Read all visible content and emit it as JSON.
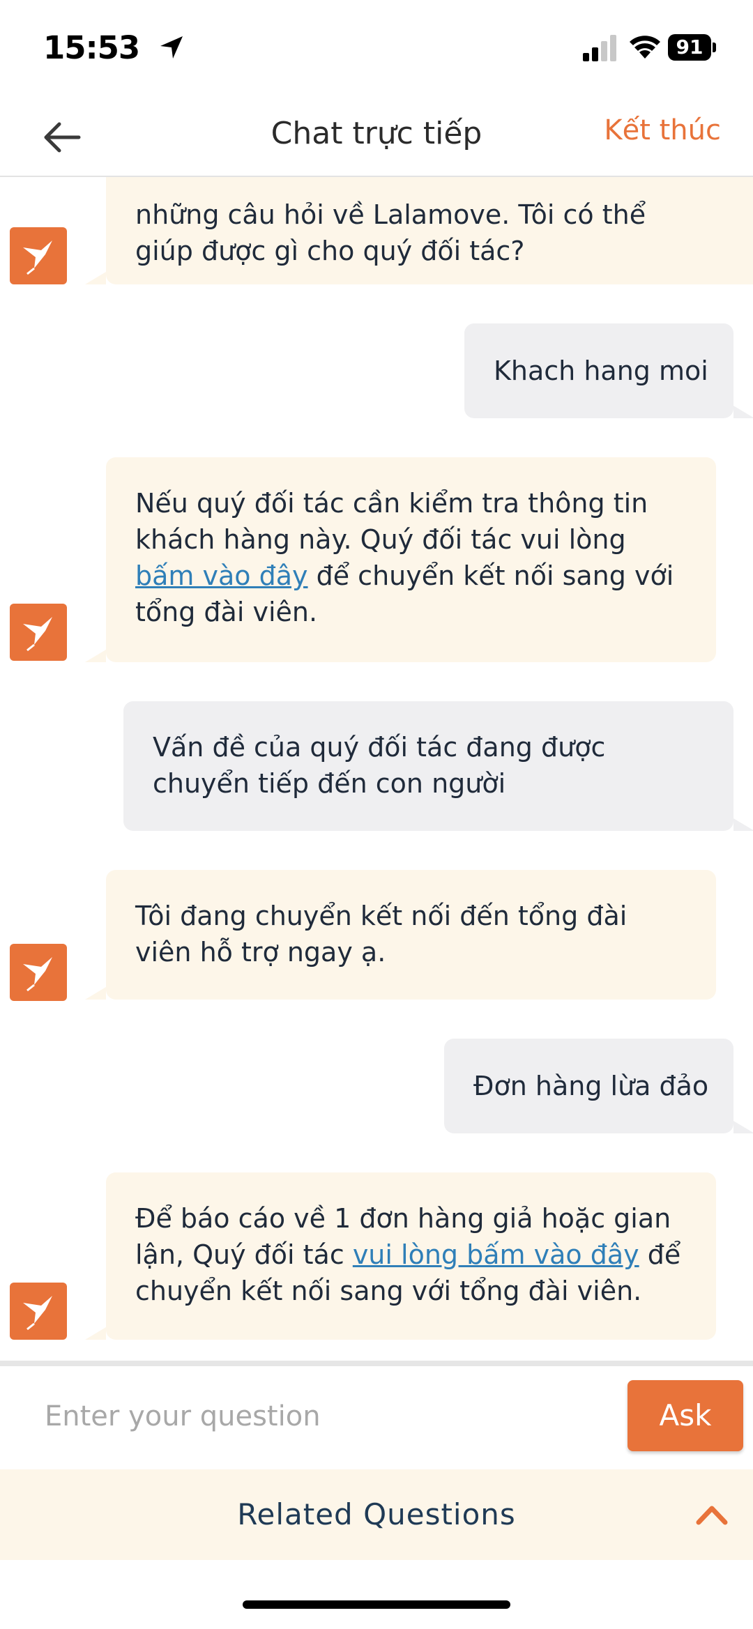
{
  "status_bar": {
    "time": "15:53",
    "battery": "91"
  },
  "header": {
    "title": "Chat trực tiếp",
    "end_label": "Kết thúc"
  },
  "messages": [
    {
      "role": "bot",
      "lines": [
        "những câu hỏi về Lalamove. Tôi có thể",
        "giúp được gì cho quý đối tác?"
      ]
    },
    {
      "role": "user",
      "text": "Khach hang moi"
    },
    {
      "role": "bot",
      "text_before": "Nếu quý đối tác cần kiểm tra thông tin khách hàng này. Quý đối tác vui lòng ",
      "link": "bấm vào đây",
      "text_after": " để chuyển kết nối sang với tổng đài viên."
    },
    {
      "role": "user",
      "text": "Vấn đề của quý đối tác đang được chuyển tiếp đến con người"
    },
    {
      "role": "bot",
      "text": "Tôi đang chuyển kết nối đến tổng đài viên hỗ trợ ngay ạ."
    },
    {
      "role": "user",
      "text": "Đơn hàng lừa đảo"
    },
    {
      "role": "bot",
      "text_before": "Để báo cáo về 1 đơn hàng giả hoặc gian lận, Quý đối tác ",
      "link": "vui lòng bấm vào đây",
      "text_after": " để chuyển kết nối sang với tổng đài viên."
    }
  ],
  "input": {
    "placeholder": "Enter your question",
    "value": ""
  },
  "ask_button": "Ask",
  "related_questions": "Related Questions",
  "colors": {
    "accent": "#e8733a",
    "bot_bubble": "#fdf6e9",
    "user_bubble": "#efeff1",
    "link": "#2f7fb8"
  },
  "icons": {
    "back": "arrow-left-icon",
    "bot_avatar": "hummingbird-icon",
    "related": "chevron-up-icon"
  }
}
